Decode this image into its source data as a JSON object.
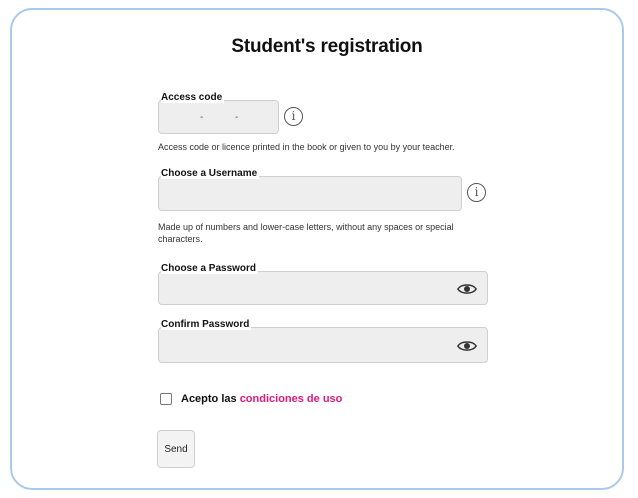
{
  "form": {
    "title": "Student's registration",
    "access_code": {
      "label": "Access code",
      "segment_separator": "-",
      "hint": "Access code or licence printed in the book or given to you by your teacher."
    },
    "username": {
      "label": "Choose a Username",
      "value": "",
      "hint_line1": "Made up of numbers and lower-case letters, without any spaces or special",
      "hint_line2": "characters."
    },
    "password": {
      "label": "Choose a Password",
      "value": ""
    },
    "confirm_password": {
      "label": "Confirm Password",
      "value": ""
    },
    "terms": {
      "checked": false,
      "prefix": "Acepto las ",
      "link_text": "condiciones de uso"
    },
    "send_label": "Send",
    "info_glyph": "i"
  },
  "colors": {
    "card_border": "#a9c9ea",
    "field_bg": "#eeeeee",
    "link": "#e0197d"
  },
  "icons": {
    "info": "info-circle-icon",
    "eye": "eye-icon"
  }
}
